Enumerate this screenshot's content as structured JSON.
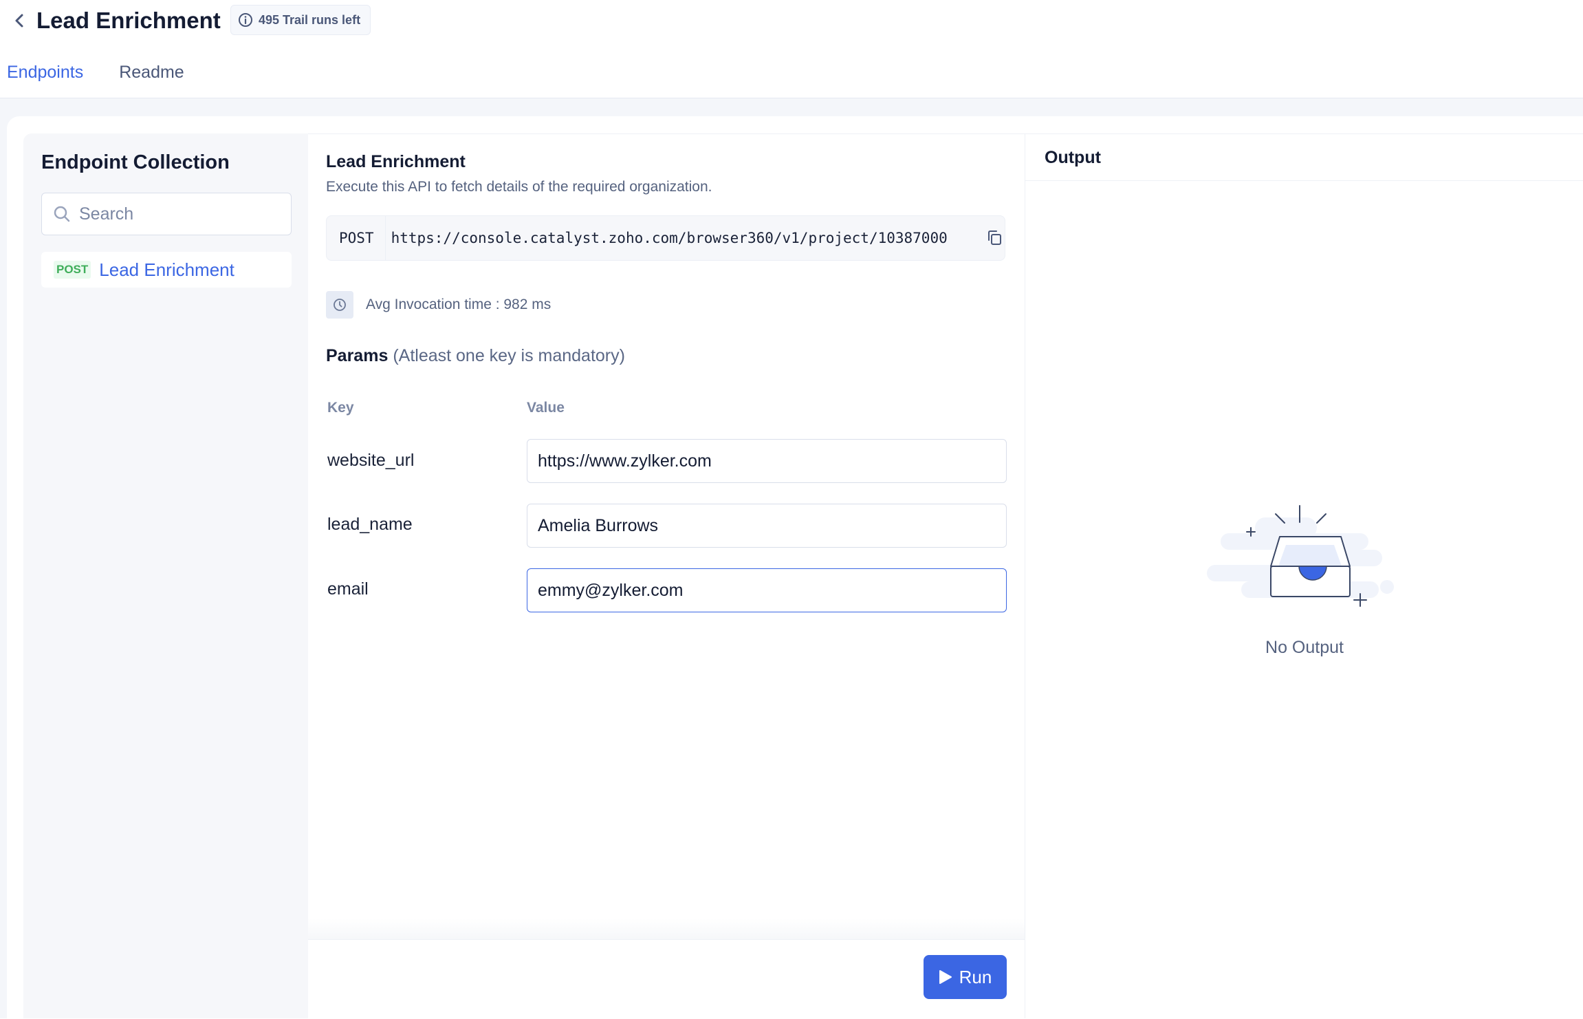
{
  "header": {
    "title": "Lead Enrichment",
    "trial_badge": "495 Trail runs left",
    "back_icon": "chevron-left-icon",
    "info_icon": "info-icon"
  },
  "tabs": [
    {
      "label": "Endpoints",
      "active": true
    },
    {
      "label": "Readme",
      "active": false
    }
  ],
  "sidebar": {
    "title": "Endpoint Collection",
    "search_placeholder": "Search",
    "search_value": "",
    "items": [
      {
        "method": "POST",
        "name": "Lead Enrichment",
        "selected": true
      }
    ]
  },
  "endpoint": {
    "title": "Lead Enrichment",
    "description": "Execute this API to fetch details of the required organization.",
    "method": "POST",
    "url": "https://console.catalyst.zoho.com/browser360/v1/project/10387000",
    "avg_invocation": "Avg Invocation time : 982 ms",
    "params_label": "Params",
    "params_note": "(Atleast one key is mandatory)",
    "key_header": "Key",
    "value_header": "Value",
    "params": [
      {
        "key": "website_url",
        "value": "https://www.zylker.com"
      },
      {
        "key": "lead_name",
        "value": "Amelia Burrows"
      },
      {
        "key": "email",
        "value": "emmy@zylker.com"
      }
    ],
    "run_label": "Run"
  },
  "output": {
    "title": "Output",
    "empty_text": "No Output"
  },
  "colors": {
    "accent": "#3b66e3",
    "post_green": "#3fae5a",
    "text_dark": "#141c33",
    "text_muted": "#55627f"
  }
}
